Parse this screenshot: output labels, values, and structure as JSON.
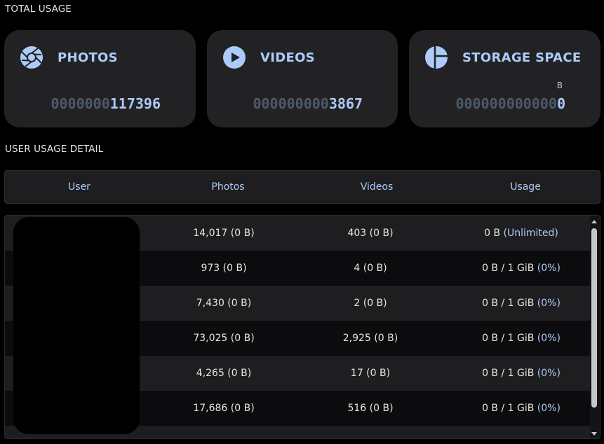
{
  "total_usage": {
    "title": "TOTAL USAGE",
    "cards": [
      {
        "label": "PHOTOS",
        "icon": "camera-aperture-icon",
        "pad": "0000000",
        "value": "117396",
        "unit": ""
      },
      {
        "label": "VIDEOS",
        "icon": "play-circle-icon",
        "pad": "000000000",
        "value": "3867",
        "unit": ""
      },
      {
        "label": "STORAGE SPACE",
        "icon": "pie-chart-icon",
        "pad": "000000000000",
        "value": "0",
        "unit": "B"
      }
    ]
  },
  "user_usage": {
    "title": "USER USAGE DETAIL",
    "columns": [
      "User",
      "Photos",
      "Videos",
      "Usage"
    ],
    "rows": [
      {
        "user": "",
        "photos": "14,017 (0 B)",
        "videos": "403 (0 B)",
        "usage": "0 B",
        "quota": "(Unlimited)"
      },
      {
        "user": "",
        "photos": "973 (0 B)",
        "videos": "4 (0 B)",
        "usage": "0 B / 1 GiB",
        "quota": "(0%)"
      },
      {
        "user": "",
        "photos": "7,430 (0 B)",
        "videos": "2 (0 B)",
        "usage": "0 B / 1 GiB",
        "quota": "(0%)"
      },
      {
        "user": "",
        "photos": "73,025 (0 B)",
        "videos": "2,925 (0 B)",
        "usage": "0 B / 1 GiB",
        "quota": "(0%)"
      },
      {
        "user": "",
        "photos": "4,265 (0 B)",
        "videos": "17 (0 B)",
        "usage": "0 B / 1 GiB",
        "quota": "(0%)"
      },
      {
        "user": "",
        "photos": "17,686 (0 B)",
        "videos": "516 (0 B)",
        "usage": "0 B / 1 GiB",
        "quota": "(0%)"
      }
    ]
  },
  "colors": {
    "accent": "#adcbfa",
    "card_bg": "#222224",
    "pad_digits": "#4e586b"
  }
}
